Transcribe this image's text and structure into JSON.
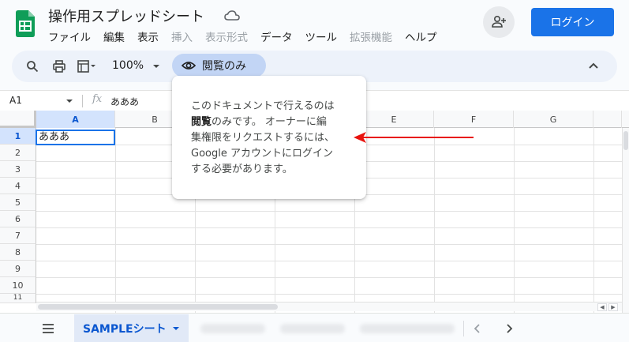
{
  "header": {
    "title": "操作用スプレッドシート",
    "menu": [
      {
        "label": "ファイル",
        "disabled": false
      },
      {
        "label": "編集",
        "disabled": false
      },
      {
        "label": "表示",
        "disabled": false
      },
      {
        "label": "挿入",
        "disabled": true
      },
      {
        "label": "表示形式",
        "disabled": true
      },
      {
        "label": "データ",
        "disabled": false
      },
      {
        "label": "ツール",
        "disabled": false
      },
      {
        "label": "拡張機能",
        "disabled": true
      },
      {
        "label": "ヘルプ",
        "disabled": false
      }
    ],
    "login_label": "ログイン",
    "accent_color": "#1a73e8"
  },
  "toolbar": {
    "zoom": "100%",
    "view_only_label": "閲覧のみ"
  },
  "formula_bar": {
    "cell_ref": "A1",
    "fx": "fx",
    "value": "あああ"
  },
  "grid": {
    "columns": [
      "A",
      "B",
      "C",
      "D",
      "E",
      "F",
      "G"
    ],
    "rows": [
      "1",
      "2",
      "3",
      "4",
      "5",
      "6",
      "7",
      "8",
      "9",
      "10",
      "11"
    ],
    "cell_a1": "あああ"
  },
  "popup": {
    "line1": "このドキュメントで行えるのは",
    "line2_bold": "閲覧",
    "line2_rest": "のみです。 オーナーに編",
    "line3": "集権限をリクエストするには、",
    "line4": "Google アカウントにログイン",
    "line5": "する必要があります。"
  },
  "sheetbar": {
    "active_sheet": "SAMPLEシート"
  }
}
